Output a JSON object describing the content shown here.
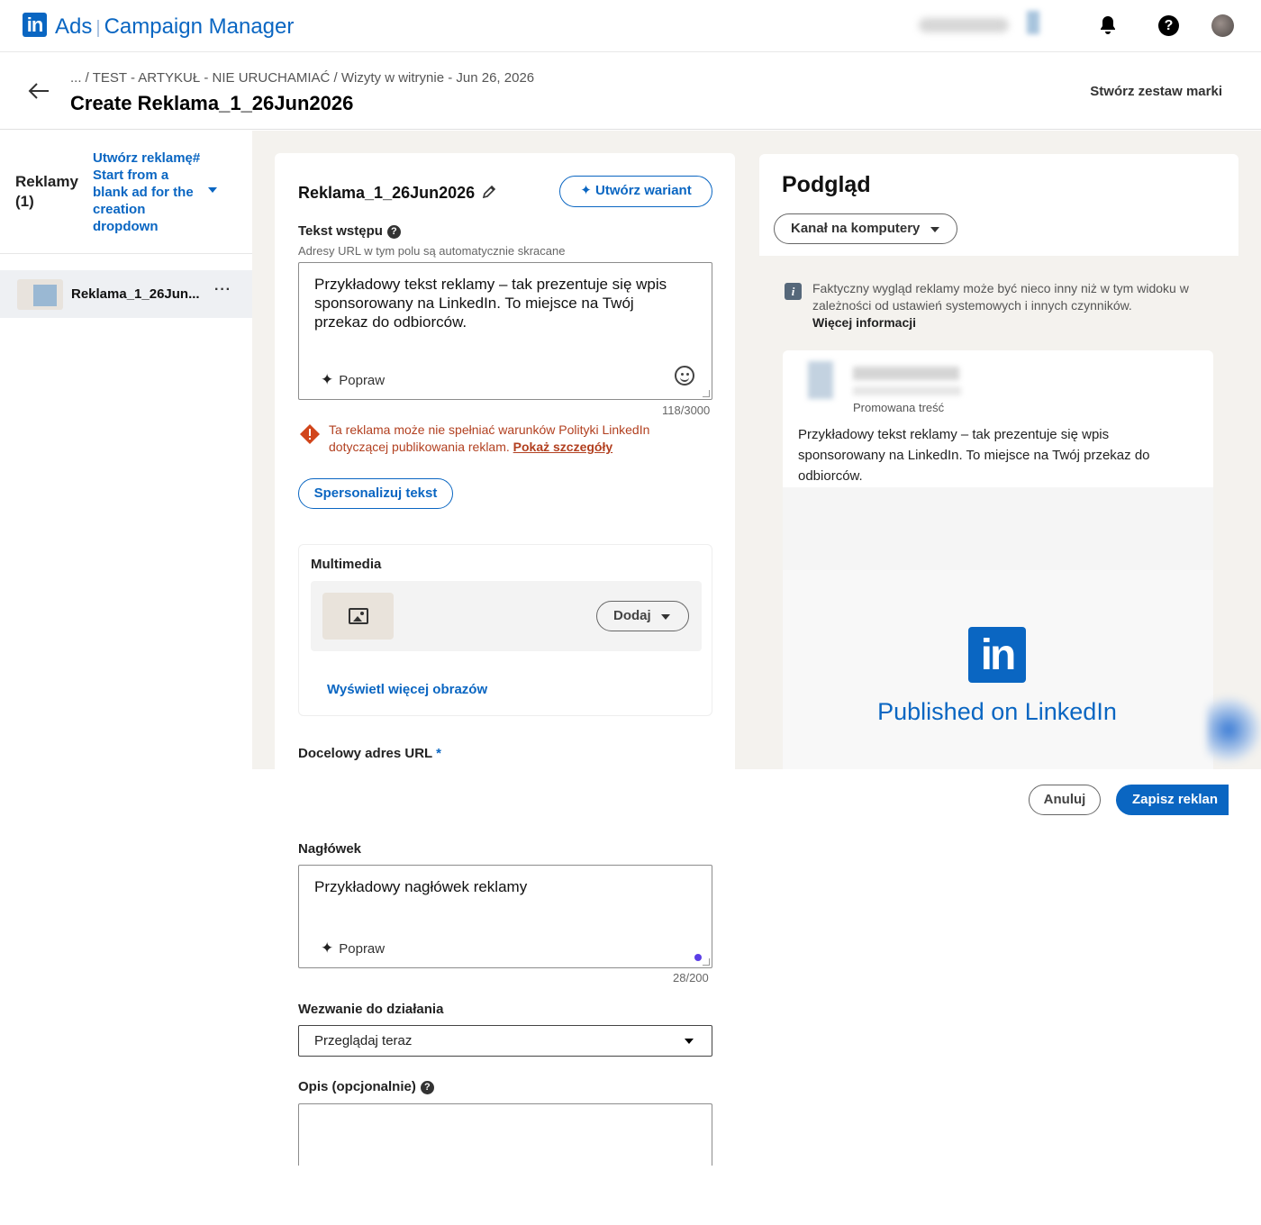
{
  "topbar": {
    "logo_text": "in",
    "app_prefix": "Ads",
    "app_name": "Campaign Manager",
    "icons": [
      "bell-icon",
      "help-icon",
      "avatar"
    ]
  },
  "header": {
    "breadcrumb": "... / TEST - ARTYKUŁ - NIE URUCHAMIAĆ / Wizyty w witrynie - Jun 26, 2026",
    "title": "Create Reklama_1_26Jun2026",
    "brand_kit": "Stwórz zestaw marki"
  },
  "sidebar": {
    "title": "Reklamy (1)",
    "create_dropdown": "Utwórz reklamę# Start from a blank ad for the creation dropdown",
    "item_label": "Reklama_1_26Jun...",
    "item_more": "···"
  },
  "editor": {
    "ad_name": "Reklama_1_26Jun2026",
    "variant_button": "Utwórz wariant",
    "intro_label": "Tekst wstępu",
    "intro_hint": "Adresy URL w tym polu są automatycznie skracane",
    "intro_text": "Przykładowy tekst reklamy – tak prezentuje się wpis sponsorowany na LinkedIn. To miejsce na Twój przekaz do odbiorców.",
    "improve": "Popraw",
    "intro_counter": "118/3000",
    "warning_text": "Ta reklama może nie spełniać warunków Polityki LinkedIn dotyczącej publikowania reklam.",
    "warning_link": "Pokaż szczegóły",
    "personalize_button": "Spersonalizuj tekst",
    "media_label": "Multimedia",
    "add_button": "Dodaj",
    "more_images": "Wyświetl więcej obrazów",
    "url_label": "Docelowy adres URL",
    "url_required": "*",
    "headline_label": "Nagłówek",
    "headline_text": "Przykładowy nagłówek reklamy",
    "headline_counter": "28/200",
    "cta_label": "Wezwanie do działania",
    "cta_value": "Przeglądaj teraz",
    "description_label": "Opis (opcjonalnie)"
  },
  "preview": {
    "title": "Podgląd",
    "feed_dropdown": "Kanał na komputery",
    "info_text": "Faktyczny wygląd reklamy może być nieco inny niż w tym widoku w zależności od ustawień systemowych i innych czynników.",
    "info_link": "Więcej informacji",
    "promoted": "Promowana treść",
    "post_text": "Przykładowy tekst reklamy – tak prezentuje się wpis sponsorowany na LinkedIn. To miejsce na Twój przekaz do odbiorców.",
    "logo_text": "in",
    "published": "Published on LinkedIn"
  },
  "footer": {
    "cancel": "Anuluj",
    "save": "Zapisz reklan"
  },
  "colors": {
    "accent": "#0a66c2",
    "warning": "#b24020",
    "canvas": "#f4f2ee"
  }
}
